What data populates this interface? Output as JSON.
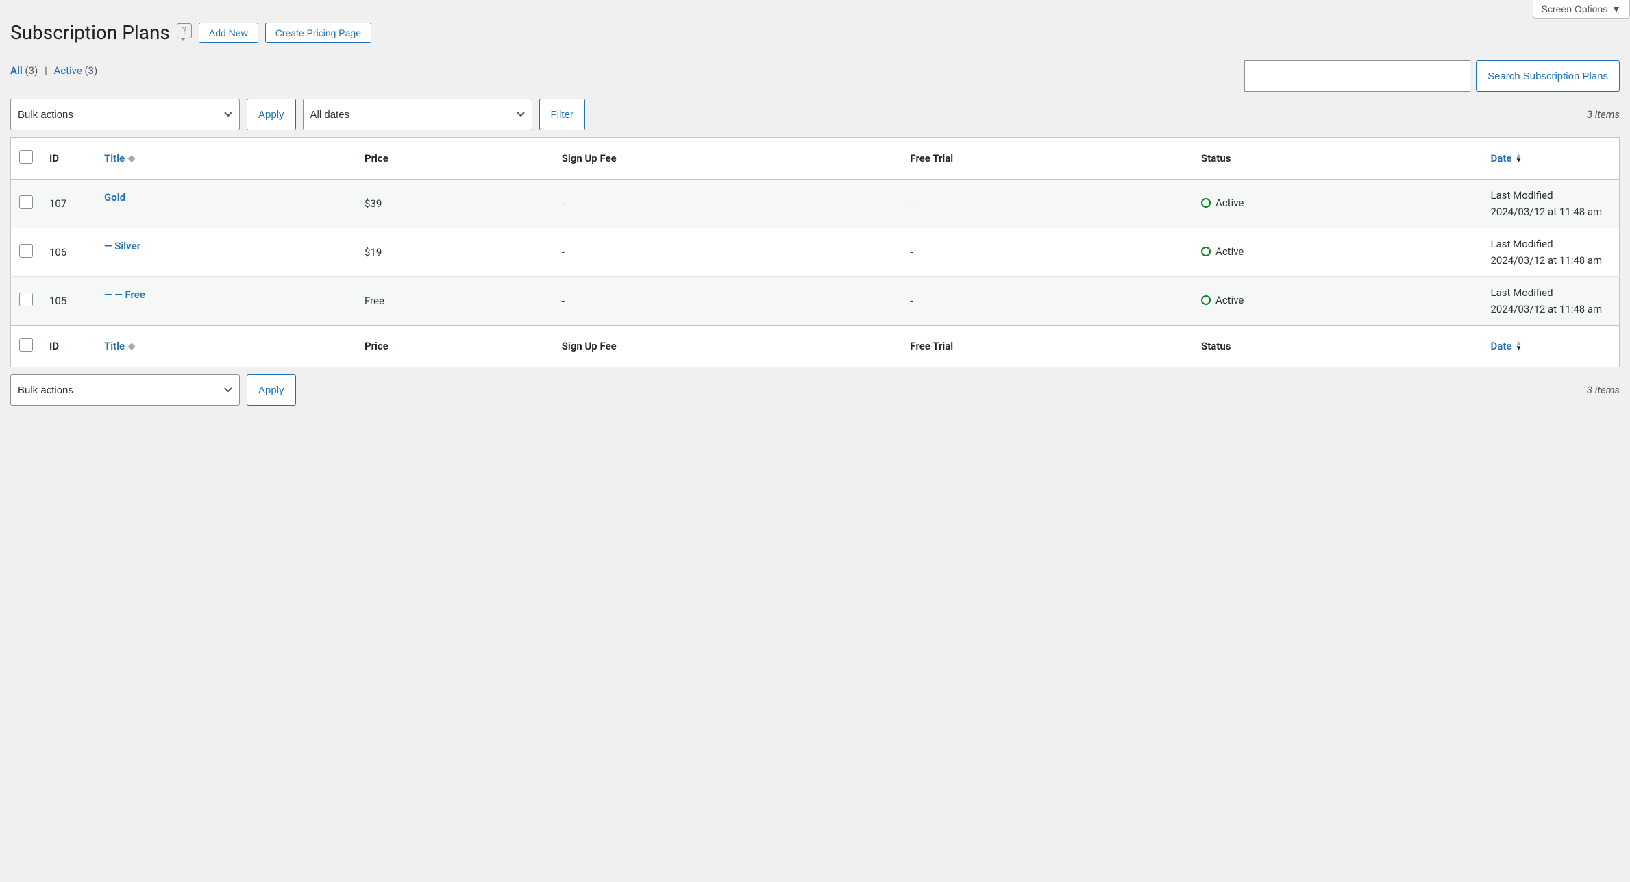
{
  "screen_options": {
    "label": "Screen Options"
  },
  "header": {
    "title": "Subscription Plans",
    "add_new": "Add New",
    "create_pricing": "Create Pricing Page"
  },
  "filters": {
    "all_label": "All",
    "all_count": "(3)",
    "active_label": "Active",
    "active_count": "(3)",
    "search_button": "Search Subscription Plans",
    "bulk_actions": "Bulk actions",
    "apply": "Apply",
    "all_dates": "All dates",
    "filter": "Filter",
    "item_count": "3 items"
  },
  "columns": {
    "id": "ID",
    "title": "Title",
    "price": "Price",
    "sign_up_fee": "Sign Up Fee",
    "free_trial": "Free Trial",
    "status": "Status",
    "date": "Date"
  },
  "rows": [
    {
      "id": "107",
      "title": "Gold",
      "price": "$39",
      "sign_up_fee": "-",
      "free_trial": "-",
      "status": "Active",
      "date_label": "Last Modified",
      "date_value": "2024/03/12 at 11:48 am"
    },
    {
      "id": "106",
      "title": "— Silver",
      "price": "$19",
      "sign_up_fee": "-",
      "free_trial": "-",
      "status": "Active",
      "date_label": "Last Modified",
      "date_value": "2024/03/12 at 11:48 am"
    },
    {
      "id": "105",
      "title": "— — Free",
      "price": "Free",
      "sign_up_fee": "-",
      "free_trial": "-",
      "status": "Active",
      "date_label": "Last Modified",
      "date_value": "2024/03/12 at 11:48 am"
    }
  ]
}
